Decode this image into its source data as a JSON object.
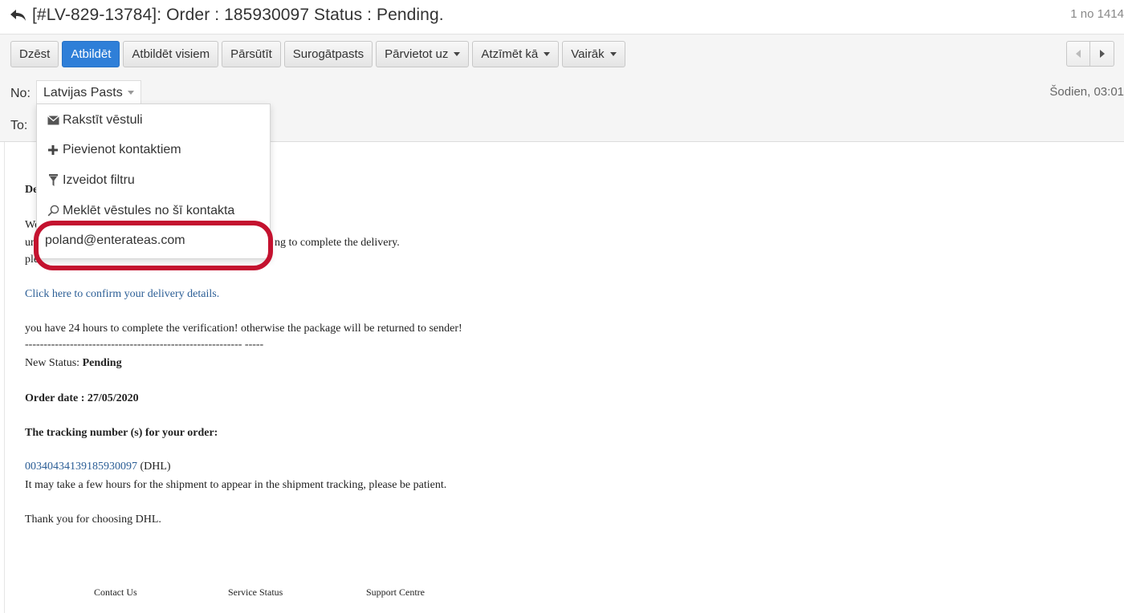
{
  "message": {
    "subject": "[#LV-829-13784]: Order : 185930097 Status : Pending.",
    "counter": "1 no 1414"
  },
  "toolbar": {
    "buttons": [
      "Dzēst",
      "Atbildēt",
      "Atbildēt visiem",
      "Pārsūtīt",
      "Surogātpasts"
    ],
    "dropdowns": [
      "Pārvietot uz",
      "Atzīmēt kā",
      "Vairāk"
    ]
  },
  "header": {
    "from_label": "No:",
    "from_name": "Latvijas Pasts",
    "to_label": "To:",
    "date": "Šodien, 03:01"
  },
  "contact_menu": {
    "items": [
      "Rakstīt vēstuli",
      "Pievienot kontaktiem",
      "Izveidot filtru",
      "Meklēt vēstules no šī kontakta"
    ],
    "email": "poland@enterateas.com"
  },
  "body": {
    "greeting_fragment": "De",
    "line1_fragment": "We",
    "line2_start": "un",
    "line2_end": "ng to complete the delivery.",
    "line3_fragment": "ple",
    "confirm_link": "Click here to confirm your delivery details.",
    "warning": "you have 24 hours to complete the verification! otherwise the package will be returned to sender!",
    "divider": "---------------------------------------------------------- -----",
    "status_label": "New Status:",
    "status_value": "Pending",
    "order_date": "Order date : 27/05/2020",
    "tracking_heading": "The tracking number (s) for your order:",
    "tracking_number": "00340434139185930097",
    "carrier": "(DHL)",
    "tracking_note": "It may take a few hours for the shipment to appear in the shipment tracking, please be patient.",
    "thanks": "Thank you for choosing DHL."
  },
  "footer": {
    "links": [
      "Contact Us",
      "Service Status",
      "Support Centre"
    ]
  },
  "colors": {
    "primary_button": "#2f7fd8",
    "highlight_ring": "#c4122f",
    "link": "#2b5e96"
  }
}
